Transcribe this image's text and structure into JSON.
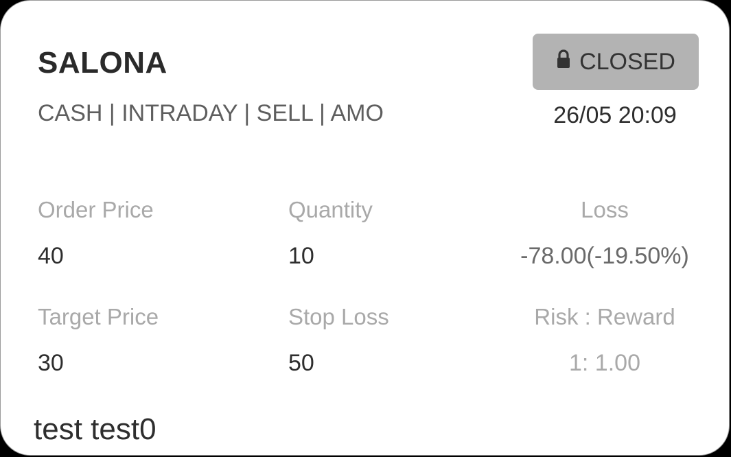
{
  "order": {
    "symbol": "SALONA",
    "tags": "CASH | INTRADAY | SELL | AMO",
    "status": "CLOSED",
    "status_icon": "lock-icon",
    "timestamp": "26/05 20:09"
  },
  "details": {
    "order_price_label": "Order Price",
    "order_price": "40",
    "quantity_label": "Quantity",
    "quantity": "10",
    "loss_label": "Loss",
    "loss": "-78.00(-19.50%)",
    "target_price_label": "Target Price",
    "target_price": "30",
    "stop_loss_label": "Stop Loss",
    "stop_loss": "50",
    "risk_reward_label": "Risk : Reward",
    "risk_reward": "1: 1.00"
  },
  "footer": {
    "name": "test test0"
  },
  "colors": {
    "card_background": "#ffffff",
    "badge_background": "#b3b3b3",
    "label_text": "#a9a9a9",
    "value_text": "#2e2e2e"
  }
}
